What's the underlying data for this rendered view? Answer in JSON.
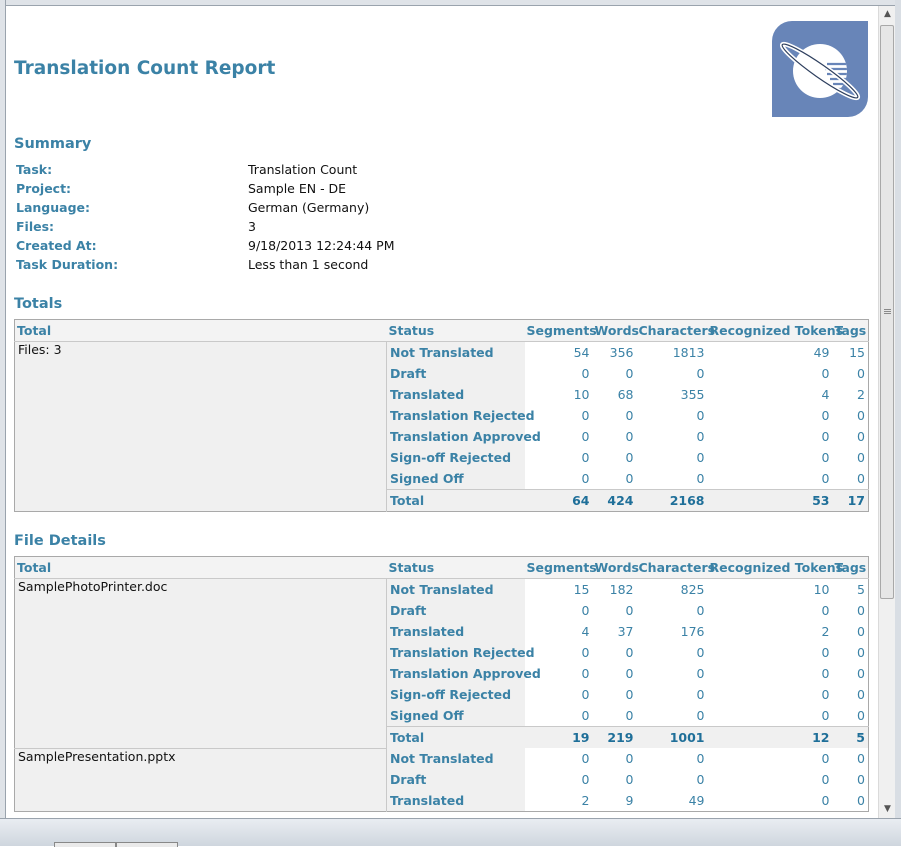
{
  "report": {
    "title": "Translation Count Report"
  },
  "logo": {
    "name": "planet-logo-icon",
    "color": "#6885b8"
  },
  "summary": {
    "heading": "Summary",
    "rows": [
      {
        "label": "Task:",
        "value": "Translation Count"
      },
      {
        "label": "Project:",
        "value": "Sample EN - DE"
      },
      {
        "label": "Language:",
        "value": "German (Germany)"
      },
      {
        "label": "Files:",
        "value": "3"
      },
      {
        "label": "Created At:",
        "value": "9/18/2013 12:24:44 PM"
      },
      {
        "label": "Task Duration:",
        "value": "Less than 1 second"
      }
    ]
  },
  "columns": [
    "Total",
    "Status",
    "Segments",
    "Words",
    "Characters",
    "Recognized Tokens",
    "Tags"
  ],
  "totals": {
    "heading": "Totals",
    "file_label": "Files: 3",
    "rows": [
      {
        "status": "Not Translated",
        "segments": "54",
        "words": "356",
        "characters": "1813",
        "tokens": "49",
        "tags": "15"
      },
      {
        "status": "Draft",
        "segments": "0",
        "words": "0",
        "characters": "0",
        "tokens": "0",
        "tags": "0"
      },
      {
        "status": "Translated",
        "segments": "10",
        "words": "68",
        "characters": "355",
        "tokens": "4",
        "tags": "2"
      },
      {
        "status": "Translation Rejected",
        "segments": "0",
        "words": "0",
        "characters": "0",
        "tokens": "0",
        "tags": "0"
      },
      {
        "status": "Translation Approved",
        "segments": "0",
        "words": "0",
        "characters": "0",
        "tokens": "0",
        "tags": "0"
      },
      {
        "status": "Sign-off Rejected",
        "segments": "0",
        "words": "0",
        "characters": "0",
        "tokens": "0",
        "tags": "0"
      },
      {
        "status": "Signed Off",
        "segments": "0",
        "words": "0",
        "characters": "0",
        "tokens": "0",
        "tags": "0"
      }
    ],
    "total": {
      "status": "Total",
      "segments": "64",
      "words": "424",
      "characters": "2168",
      "tokens": "53",
      "tags": "17"
    }
  },
  "file_details": {
    "heading": "File Details",
    "files": [
      {
        "name": "SamplePhotoPrinter.doc",
        "rows": [
          {
            "status": "Not Translated",
            "segments": "15",
            "words": "182",
            "characters": "825",
            "tokens": "10",
            "tags": "5"
          },
          {
            "status": "Draft",
            "segments": "0",
            "words": "0",
            "characters": "0",
            "tokens": "0",
            "tags": "0"
          },
          {
            "status": "Translated",
            "segments": "4",
            "words": "37",
            "characters": "176",
            "tokens": "2",
            "tags": "0"
          },
          {
            "status": "Translation Rejected",
            "segments": "0",
            "words": "0",
            "characters": "0",
            "tokens": "0",
            "tags": "0"
          },
          {
            "status": "Translation Approved",
            "segments": "0",
            "words": "0",
            "characters": "0",
            "tokens": "0",
            "tags": "0"
          },
          {
            "status": "Sign-off Rejected",
            "segments": "0",
            "words": "0",
            "characters": "0",
            "tokens": "0",
            "tags": "0"
          },
          {
            "status": "Signed Off",
            "segments": "0",
            "words": "0",
            "characters": "0",
            "tokens": "0",
            "tags": "0"
          }
        ],
        "total": {
          "status": "Total",
          "segments": "19",
          "words": "219",
          "characters": "1001",
          "tokens": "12",
          "tags": "5"
        }
      },
      {
        "name": "SamplePresentation.pptx",
        "rows": [
          {
            "status": "Not Translated",
            "segments": "0",
            "words": "0",
            "characters": "0",
            "tokens": "0",
            "tags": "0"
          },
          {
            "status": "Draft",
            "segments": "0",
            "words": "0",
            "characters": "0",
            "tokens": "0",
            "tags": "0"
          },
          {
            "status": "Translated",
            "segments": "2",
            "words": "9",
            "characters": "49",
            "tokens": "0",
            "tags": "0"
          }
        ]
      }
    ]
  },
  "scrollbar": {
    "up_icon": "arrow-up-icon",
    "down_icon": "arrow-down-icon"
  }
}
